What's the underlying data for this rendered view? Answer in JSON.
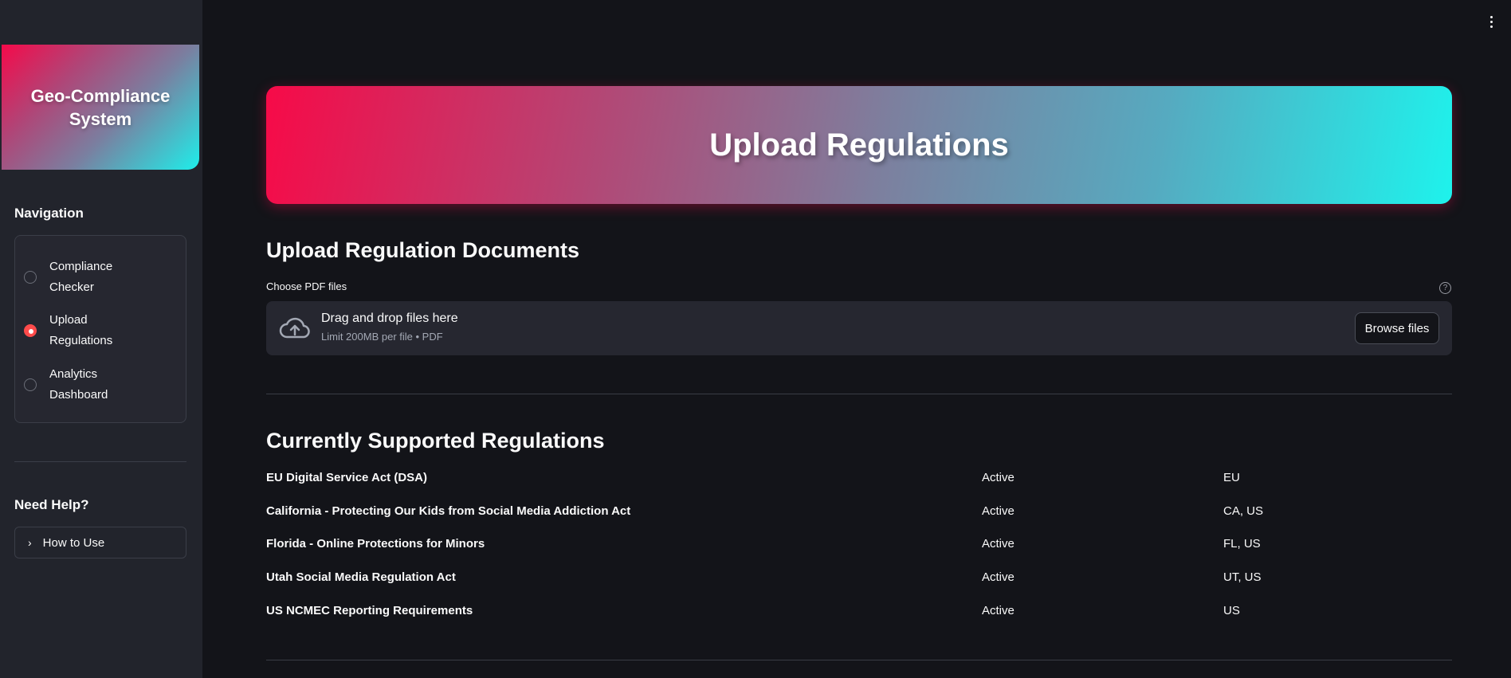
{
  "sidebar": {
    "logo_text": "Geo-Compliance System",
    "nav_heading": "Navigation",
    "nav_items": [
      {
        "label": "Compliance Checker",
        "selected": false
      },
      {
        "label": "Upload Regulations",
        "selected": true
      },
      {
        "label": "Analytics Dashboard",
        "selected": false
      }
    ],
    "help_heading": "Need Help?",
    "help_expander": "How to Use"
  },
  "main": {
    "banner_title": "Upload Regulations",
    "upload_section_title": "Upload Regulation Documents",
    "uploader": {
      "label": "Choose PDF files",
      "help_glyph": "?",
      "drop_text": "Drag and drop files here",
      "limit_text": "Limit 200MB per file • PDF",
      "browse_label": "Browse files"
    },
    "regulations_title": "Currently Supported Regulations",
    "regulations": [
      {
        "name": "EU Digital Service Act (DSA)",
        "status": "Active",
        "region": "EU"
      },
      {
        "name": "California - Protecting Our Kids from Social Media Addiction Act",
        "status": "Active",
        "region": "CA, US"
      },
      {
        "name": "Florida - Online Protections for Minors",
        "status": "Active",
        "region": "FL, US"
      },
      {
        "name": "Utah Social Media Regulation Act",
        "status": "Active",
        "region": "UT, US"
      },
      {
        "name": "US NCMEC Reporting Requirements",
        "status": "Active",
        "region": "US"
      }
    ]
  },
  "colors": {
    "background": "#131419",
    "sidebar": "#22242c",
    "accent_red": "#ff4b4b",
    "gradient_start": "#f70a48",
    "gradient_end": "#1ef2ec"
  },
  "icons": [
    "kebab-menu-icon",
    "cloud-upload-icon",
    "help-icon",
    "chevron-right-icon"
  ]
}
